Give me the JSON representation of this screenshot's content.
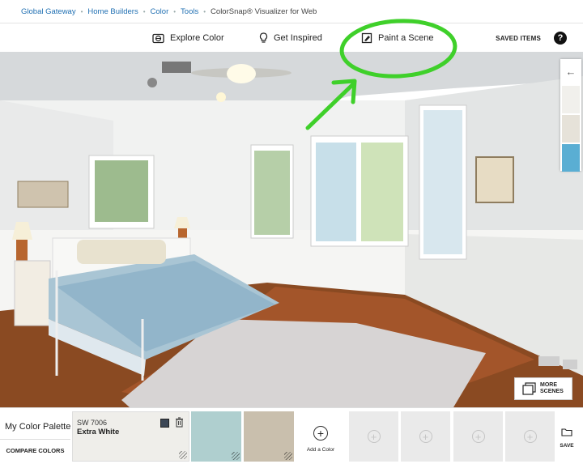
{
  "breadcrumb": {
    "items": [
      "Global Gateway",
      "Home Builders",
      "Color",
      "Tools"
    ],
    "current": "ColorSnap® Visualizer for Web"
  },
  "topnav": {
    "explore": "Explore Color",
    "inspired": "Get Inspired",
    "paint": "Paint a Scene",
    "saved": "SAVED ITEMS",
    "help": "?"
  },
  "swatch_column": {
    "back_arrow": "←",
    "colors": [
      "#f1f0ec",
      "#e6e2d9",
      "#5aaed3"
    ]
  },
  "more_scenes": {
    "line1": "MORE",
    "line2": "SCENES"
  },
  "palette": {
    "title": "My Color Palette",
    "compare": "COMPARE COLORS",
    "chip1": {
      "number": "SW 7006",
      "name": "Extra White",
      "color": "#efeeea"
    },
    "chip2_color": "#afcfcf",
    "chip3_color": "#c9bfad",
    "add_label": "Add a Color",
    "add_symbol": "+",
    "empty_slots": [
      "+",
      "+",
      "+",
      "+"
    ],
    "save_label": "SAVE"
  },
  "annotation": {
    "color": "#3fd02a"
  },
  "icons": [
    "globe-icon",
    "lightbulb-icon",
    "paintbrush-icon",
    "help-icon",
    "trash-icon",
    "stack-icon",
    "folder-icon"
  ]
}
